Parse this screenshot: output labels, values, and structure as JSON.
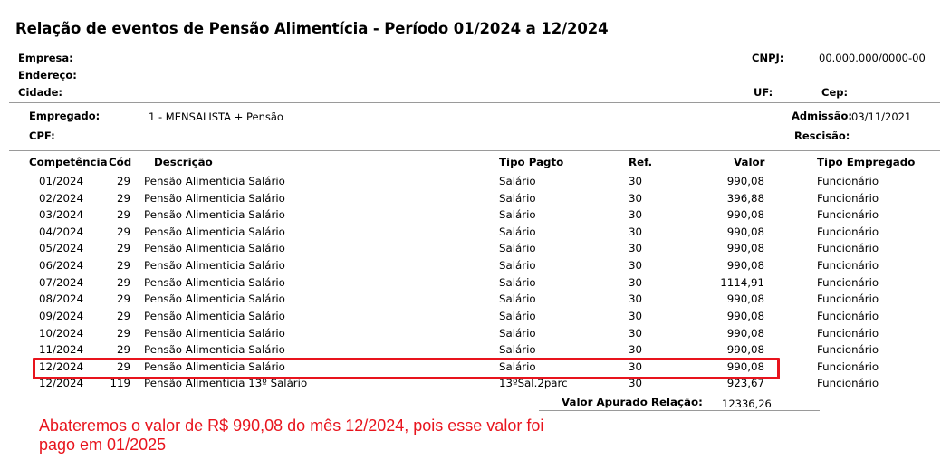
{
  "report": {
    "title": "Relação de eventos de Pensão Alimentícia - Período 01/2024 a 12/2024"
  },
  "company": {
    "empresa_label": "Empresa:",
    "endereco_label": "Endereço:",
    "cidade_label": "Cidade:",
    "cnpj_label": "CNPJ:",
    "cnpj_value": "00.000.000/0000-00",
    "uf_label": "UF:",
    "cep_label": "Cep:"
  },
  "employee": {
    "empregado_label": "Empregado:",
    "empregado_value": "1  - MENSALISTA + Pensão",
    "cpf_label": "CPF:",
    "admissao_label": "Admissão:",
    "admissao_value": "03/11/2021",
    "rescisao_label": "Rescisão:"
  },
  "table": {
    "headers": {
      "competencia": "Competência",
      "cod": "Cód",
      "descricao": "Descrição",
      "tipo_pagto": "Tipo Pagto",
      "ref": "Ref.",
      "valor": "Valor",
      "tipo_empregado": "Tipo Empregado"
    },
    "rows": [
      {
        "competencia": "01/2024",
        "cod": "29",
        "descricao": "Pensão Alimenticia Salário",
        "tipo_pagto": "Salário",
        "ref": "30",
        "valor": "990,08",
        "tipo_empregado": "Funcionário"
      },
      {
        "competencia": "02/2024",
        "cod": "29",
        "descricao": "Pensão Alimenticia Salário",
        "tipo_pagto": "Salário",
        "ref": "30",
        "valor": "396,88",
        "tipo_empregado": "Funcionário"
      },
      {
        "competencia": "03/2024",
        "cod": "29",
        "descricao": "Pensão Alimenticia Salário",
        "tipo_pagto": "Salário",
        "ref": "30",
        "valor": "990,08",
        "tipo_empregado": "Funcionário"
      },
      {
        "competencia": "04/2024",
        "cod": "29",
        "descricao": "Pensão Alimenticia Salário",
        "tipo_pagto": "Salário",
        "ref": "30",
        "valor": "990,08",
        "tipo_empregado": "Funcionário"
      },
      {
        "competencia": "05/2024",
        "cod": "29",
        "descricao": "Pensão Alimenticia Salário",
        "tipo_pagto": "Salário",
        "ref": "30",
        "valor": "990,08",
        "tipo_empregado": "Funcionário"
      },
      {
        "competencia": "06/2024",
        "cod": "29",
        "descricao": "Pensão Alimenticia Salário",
        "tipo_pagto": "Salário",
        "ref": "30",
        "valor": "990,08",
        "tipo_empregado": "Funcionário"
      },
      {
        "competencia": "07/2024",
        "cod": "29",
        "descricao": "Pensão Alimenticia Salário",
        "tipo_pagto": "Salário",
        "ref": "30",
        "valor": "1114,91",
        "tipo_empregado": "Funcionário"
      },
      {
        "competencia": "08/2024",
        "cod": "29",
        "descricao": "Pensão Alimenticia Salário",
        "tipo_pagto": "Salário",
        "ref": "30",
        "valor": "990,08",
        "tipo_empregado": "Funcionário"
      },
      {
        "competencia": "09/2024",
        "cod": "29",
        "descricao": "Pensão Alimenticia Salário",
        "tipo_pagto": "Salário",
        "ref": "30",
        "valor": "990,08",
        "tipo_empregado": "Funcionário"
      },
      {
        "competencia": "10/2024",
        "cod": "29",
        "descricao": "Pensão Alimenticia Salário",
        "tipo_pagto": "Salário",
        "ref": "30",
        "valor": "990,08",
        "tipo_empregado": "Funcionário"
      },
      {
        "competencia": "11/2024",
        "cod": "29",
        "descricao": "Pensão Alimenticia Salário",
        "tipo_pagto": "Salário",
        "ref": "30",
        "valor": "990,08",
        "tipo_empregado": "Funcionário"
      },
      {
        "competencia": "12/2024",
        "cod": "29",
        "descricao": "Pensão Alimenticia Salário",
        "tipo_pagto": "Salário",
        "ref": "30",
        "valor": "990,08",
        "tipo_empregado": "Funcionário"
      },
      {
        "competencia": "12/2024",
        "cod": "119",
        "descricao": "Pensão Alimenticia 13º Salário",
        "tipo_pagto": "13ºSal.2parc",
        "ref": "30",
        "valor": "923,67",
        "tipo_empregado": "Funcionário"
      }
    ],
    "highlighted_row_index": 11
  },
  "totals": {
    "label": "Valor Apurado Relação:",
    "value": "12336,26"
  },
  "annotation": {
    "text": "Abateremos o valor de R$ 990,08 do mês 12/2024, pois esse valor foi pago em 01/2025",
    "color": "#e8141d"
  }
}
